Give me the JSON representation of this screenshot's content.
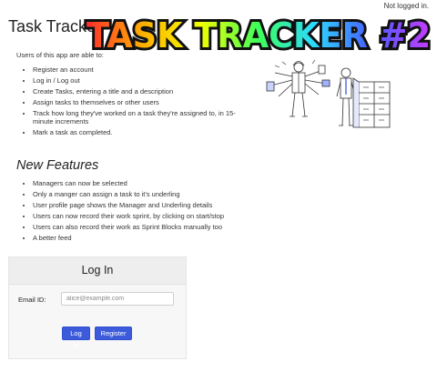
{
  "header": {
    "status": "Not logged in.",
    "title": "Task Tracker",
    "banner_text": "TASK TRACKER #2"
  },
  "intro": {
    "text": "Users of this app are able to:",
    "items": [
      "Register an account",
      "Log in / Log out",
      "Create Tasks, entering a title and a description",
      "Assign tasks to themselves or other users",
      "Track how long they've worked on a task they're assigned to, in 15-minute increments",
      "Mark a task as completed."
    ]
  },
  "new_features": {
    "heading": "New Features",
    "items": [
      "Managers can now be selected",
      "Only a manger can assign a task to it's underling",
      "User profile page shows the Manager and Underling details",
      "Users can now record their work sprint, by clicking on start/stop",
      "Users can also record their work as Sprint Blocks manually too",
      "A better feed"
    ]
  },
  "login": {
    "heading": "Log In",
    "email_label": "Email ID:",
    "email_placeholder": "alice@example.com",
    "email_value": "",
    "login_label": "Log in",
    "register_label": "Register"
  },
  "colors": {
    "button": "#3b5bdb",
    "banner_gradient": [
      "#ff2d2d",
      "#ffae00",
      "#f3ff00",
      "#3dff5a",
      "#2bd9ff",
      "#4a5bff",
      "#c63bff"
    ]
  },
  "icons": {
    "illustration": "busy-office-workers-illustration"
  }
}
